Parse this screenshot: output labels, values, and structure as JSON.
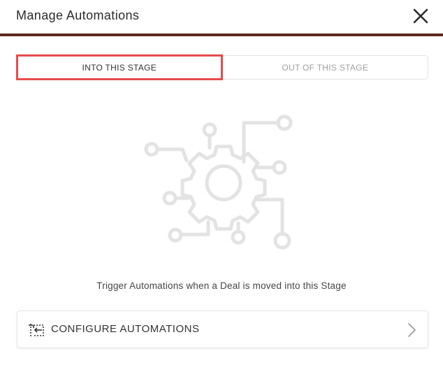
{
  "header": {
    "title": "Manage Automations"
  },
  "tabs": [
    {
      "label": "INTO THIS STAGE",
      "active": true
    },
    {
      "label": "OUT OF THIS STAGE",
      "active": false
    }
  ],
  "illustration": {
    "icon": "automation-gear-icon"
  },
  "empty_state": {
    "text": "Trigger Automations when a Deal is moved into this Stage"
  },
  "configure": {
    "label": "CONFIGURE AUTOMATIONS",
    "icon": "configure-automation-icon",
    "chevron": "chevron-right-icon"
  },
  "colors": {
    "header_border": "#5e2a1f",
    "active_tab_outline": "#e84b4b",
    "illustration": "#e3e3e3"
  }
}
